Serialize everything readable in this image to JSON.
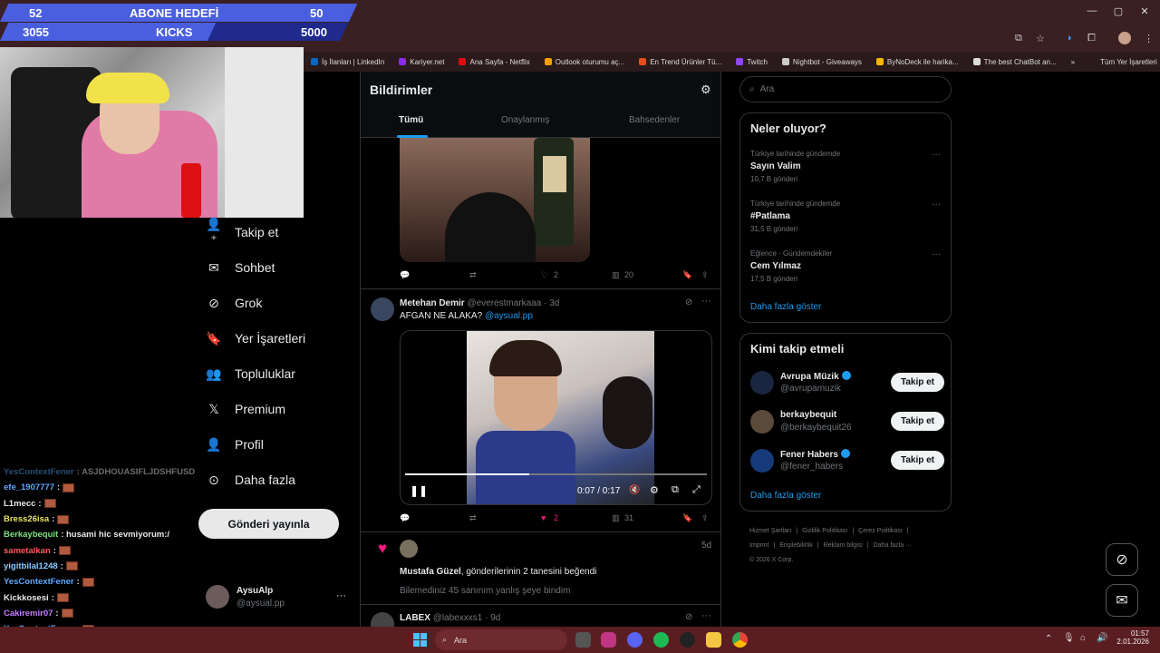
{
  "overlay": {
    "row1": {
      "left": "52",
      "title": "ABONE HEDEFİ",
      "right": "50",
      "progress": 1.0
    },
    "row2": {
      "left": "3055",
      "title": "KICKS",
      "right": "5000",
      "progress": 0.61
    }
  },
  "bookmarks": [
    {
      "label": "İş İlanları | LinkedIn",
      "color": "#0a66c2"
    },
    {
      "label": "Kariyer.net",
      "color": "#8b2be2"
    },
    {
      "label": "Ana Sayfa - Netflix",
      "color": "#e50914"
    },
    {
      "label": "Outlook oturumu aç...",
      "color": "#f0a000"
    },
    {
      "label": "En Trend Ürünler Tü...",
      "color": "#e74c1c"
    },
    {
      "label": "Twitch",
      "color": "#9146ff"
    },
    {
      "label": "Nightbot - Giveaways",
      "color": "#cccccc"
    },
    {
      "label": "ByNoDeck ile harika...",
      "color": "#f5b800"
    },
    {
      "label": "The best ChatBot an...",
      "color": "#dddddd"
    },
    {
      "label": "»",
      "color": ""
    },
    {
      "label": "Tüm Yer İşaretleri",
      "color": ""
    }
  ],
  "nav": {
    "items": [
      "Takip et",
      "Sohbet",
      "Grok",
      "Yer İşaretleri",
      "Topluluklar",
      "Premium",
      "Profil",
      "Daha fazla"
    ],
    "icons": [
      "add-user-icon",
      "mail-icon",
      "grok-icon",
      "bookmark-icon",
      "communities-icon",
      "x-icon",
      "profile-icon",
      "more-icon"
    ],
    "post_button": "Gönderi yayınla",
    "account": {
      "name": "AysuAlp",
      "handle": "@aysual.pp",
      "more": "···"
    }
  },
  "chat": [
    {
      "user": "YesContextFener",
      "msg": ": ASJDHOUASIFLJDSHFUSDLFJSDSF",
      "color": "#5da8ff",
      "emote": false,
      "dim": true
    },
    {
      "user": "efe_1907777",
      "msg": ":",
      "color": "#5da8ff",
      "emote": true
    },
    {
      "user": "L1mecc",
      "msg": ":",
      "color": "#e7e9ea",
      "emote": true
    },
    {
      "user": "Bress26isa",
      "msg": ":",
      "color": "#e9e36a",
      "emote": true
    },
    {
      "user": "Berkaybequit",
      "msg": ": husami hic sevmiyorum:/",
      "color": "#7ee07e",
      "emote": false
    },
    {
      "user": "sametalkan",
      "msg": ":",
      "color": "#ff5a5a",
      "emote": true
    },
    {
      "user": "yigitbilal1248",
      "msg": ":",
      "color": "#8ecbff",
      "emote": true
    },
    {
      "user": "YesContextFener",
      "msg": ":",
      "color": "#5da8ff",
      "emote": true
    },
    {
      "user": "Kickkosesi",
      "msg": ":",
      "color": "#e7e9ea",
      "emote": true
    },
    {
      "user": "Cakiremir07",
      "msg": ":",
      "color": "#c77dff",
      "emote": true
    },
    {
      "user": "YesContextFener",
      "msg": ":",
      "color": "#5da8ff",
      "emote": true
    },
    {
      "user": "YesContextFener",
      "msg": ":",
      "color": "#5da8ff",
      "emote": true
    }
  ],
  "main": {
    "title": "Bildirimler",
    "tabs": [
      "Tümü",
      "Onaylanmış",
      "Bahsedenler"
    ],
    "post1_actions": {
      "likes": "2",
      "views": "20"
    },
    "post2": {
      "name": "Metehan Demir",
      "handle": "@everestmarkaaa · 3d",
      "text": "AFGAN NE ALAKA?",
      "mention": "@aysual.pp",
      "time": "0:07 / 0:17",
      "likes": "2",
      "views": "31",
      "progress": 0.41
    },
    "notif": {
      "time": "5d",
      "name": "Mustafa Güzel",
      "text": ", gönderilerinin 2 tanesini beğendi",
      "quote": "Bilemediniz 45 sanınım yanlış şeye bindim"
    },
    "post3": {
      "name": "LABEX",
      "handle": "@labexxxs1 · 9d"
    }
  },
  "right": {
    "search_placeholder": "Ara",
    "trends_title": "Neler oluyor?",
    "trends": [
      {
        "cat": "Türkiye tarihinde gündemde",
        "name": "Sayın Valim",
        "count": "10,7 B gönderi"
      },
      {
        "cat": "Türkiye tarihinde gündemde",
        "name": "#Patlama",
        "count": "31,5 B gönderi"
      },
      {
        "cat": "Eğlence · Gündemdekiler",
        "name": "Cem Yılmaz",
        "count": "17,5 B gönderi"
      }
    ],
    "show_more": "Daha fazla göster",
    "who_title": "Kimi takip etmeli",
    "who": [
      {
        "name": "Avrupa Müzik",
        "handle": "@avrupamuzik",
        "verified": true,
        "color": "#1a2540"
      },
      {
        "name": "berkaybequit",
        "handle": "@berkaybequit26",
        "verified": false,
        "color": "#5a4a3a"
      },
      {
        "name": "Fener Habers",
        "handle": "@fener_habers",
        "verified": true,
        "color": "#173a7a"
      }
    ],
    "follow_label": "Takip et",
    "footer": [
      "Hizmet Şartları",
      "|",
      "Gizlilik Politikası",
      "|",
      "Çerez Politikası",
      "|",
      "Imprint",
      "|",
      "Erişilebilirlik",
      "|",
      "Reklam bilgisi",
      "|",
      "Daha fazla ···",
      "© 2026 X Corp."
    ]
  },
  "taskbar": {
    "search": "Ara",
    "time": "01:57",
    "date": "2.01.2026"
  }
}
